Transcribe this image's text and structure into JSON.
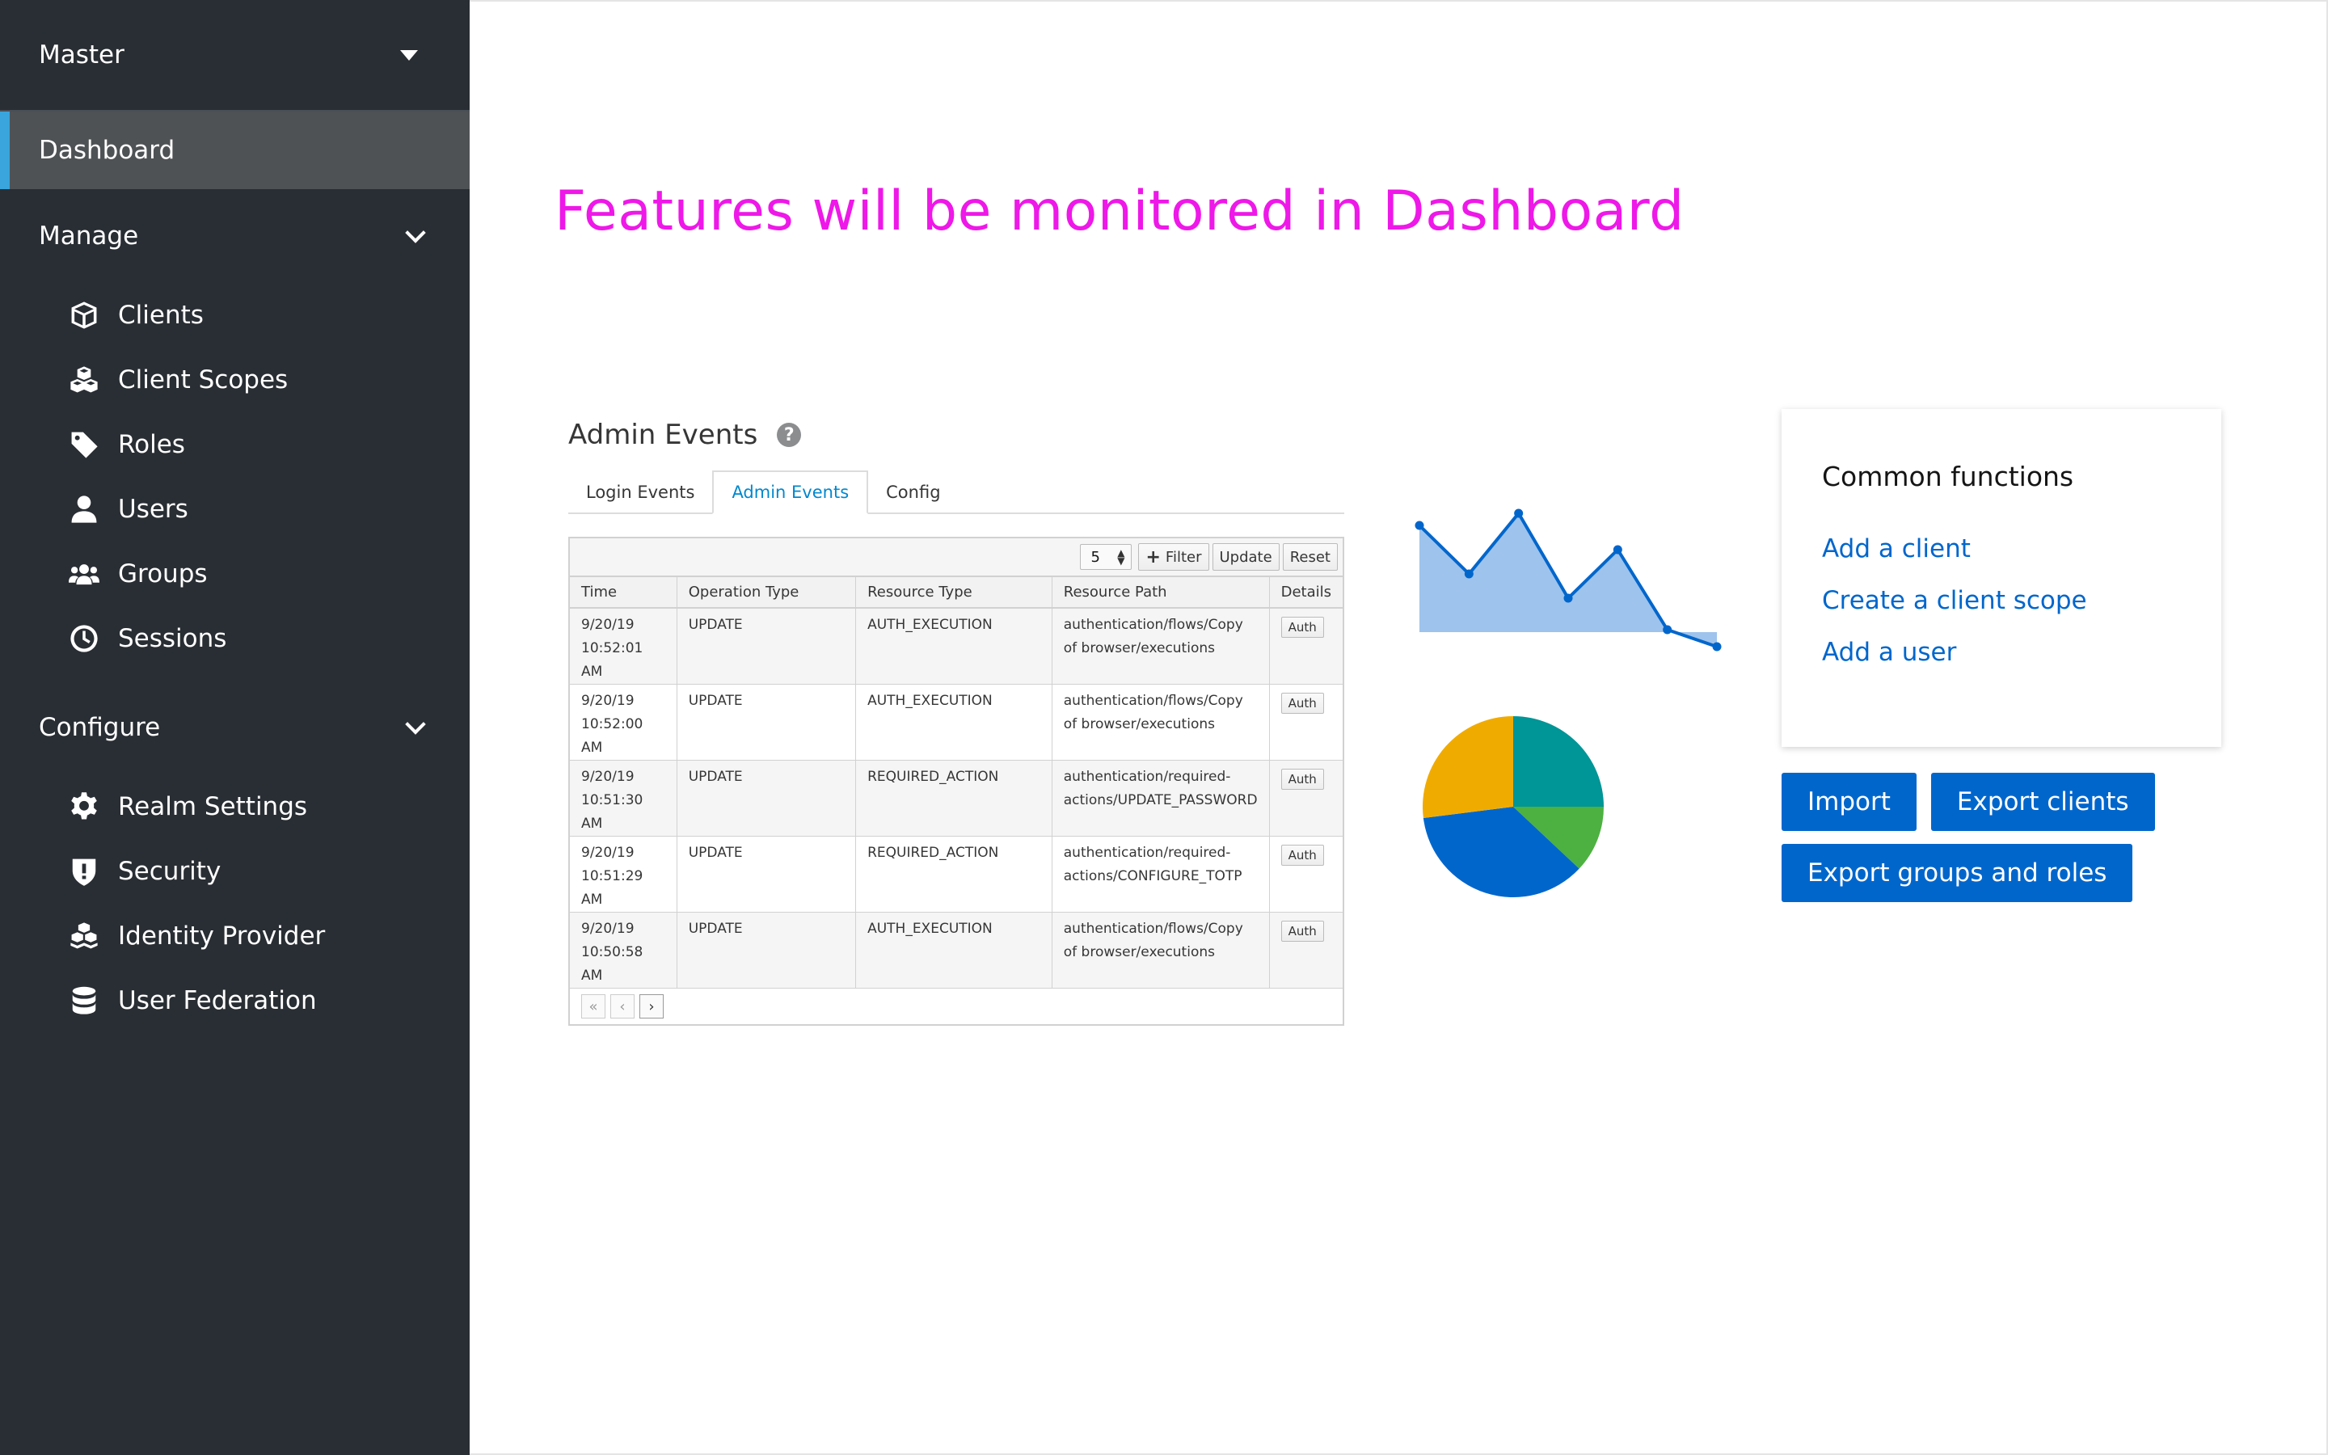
{
  "sidebar": {
    "realm": "Master",
    "dashboard": "Dashboard",
    "manage": {
      "label": "Manage",
      "items": [
        {
          "label": "Clients",
          "icon": "cube-icon"
        },
        {
          "label": "Client Scopes",
          "icon": "cubes-icon"
        },
        {
          "label": "Roles",
          "icon": "tag-icon"
        },
        {
          "label": "Users",
          "icon": "user-icon"
        },
        {
          "label": "Groups",
          "icon": "users-icon"
        },
        {
          "label": "Sessions",
          "icon": "clock-icon"
        }
      ]
    },
    "configure": {
      "label": "Configure",
      "items": [
        {
          "label": "Realm Settings",
          "icon": "gear-icon"
        },
        {
          "label": "Security",
          "icon": "shield-icon"
        },
        {
          "label": "Identity Provider",
          "icon": "cubes-stack-icon"
        },
        {
          "label": "User Federation",
          "icon": "database-icon"
        }
      ]
    }
  },
  "headline": "Features will be monitored in Dashboard",
  "events": {
    "title": "Admin Events",
    "tabs": [
      "Login Events",
      "Admin Events",
      "Config"
    ],
    "active_tab": "Admin Events",
    "toolbar": {
      "page_size": "5",
      "filter": "Filter",
      "update": "Update",
      "reset": "Reset"
    },
    "columns": [
      "Time",
      "Operation Type",
      "Resource Type",
      "Resource Path",
      "Details"
    ],
    "rows": [
      {
        "date": "9/20/19",
        "time": "10:52:01 AM",
        "op": "UPDATE",
        "rtype": "AUTH_EXECUTION",
        "path1": "authentication/flows/Copy",
        "path2": "of browser/executions",
        "details": "Auth"
      },
      {
        "date": "9/20/19",
        "time": "10:52:00 AM",
        "op": "UPDATE",
        "rtype": "AUTH_EXECUTION",
        "path1": "authentication/flows/Copy",
        "path2": "of browser/executions",
        "details": "Auth"
      },
      {
        "date": "9/20/19",
        "time": "10:51:30 AM",
        "op": "UPDATE",
        "rtype": "REQUIRED_ACTION",
        "path1": "authentication/required-",
        "path2": "actions/UPDATE_PASSWORD",
        "details": "Auth"
      },
      {
        "date": "9/20/19",
        "time": "10:51:29 AM",
        "op": "UPDATE",
        "rtype": "REQUIRED_ACTION",
        "path1": "authentication/required-",
        "path2": "actions/CONFIGURE_TOTP",
        "details": "Auth"
      },
      {
        "date": "9/20/19",
        "time": "10:50:58 AM",
        "op": "UPDATE",
        "rtype": "AUTH_EXECUTION",
        "path1": "authentication/flows/Copy",
        "path2": "of browser/executions",
        "details": "Auth"
      }
    ],
    "pager": [
      "«",
      "‹",
      "›"
    ]
  },
  "chart_data": [
    {
      "type": "area",
      "x": [
        1,
        2,
        3,
        4,
        5,
        6,
        7
      ],
      "values": [
        5,
        3,
        5.5,
        2,
        4,
        0.7,
        0
      ],
      "ylim": [
        0,
        6
      ],
      "color": "#9ec3ec",
      "line_color": "#0066cc"
    },
    {
      "type": "pie",
      "values": [
        25,
        12,
        36,
        27
      ],
      "colors": [
        "#009596",
        "#4cb140",
        "#0066cc",
        "#f0ab00"
      ]
    }
  ],
  "common": {
    "title": "Common functions",
    "links": [
      "Add a client",
      "Create a client scope",
      "Add a user"
    ]
  },
  "buttons": {
    "import": "Import",
    "export_clients": "Export clients",
    "export_groups": "Export groups and roles"
  }
}
